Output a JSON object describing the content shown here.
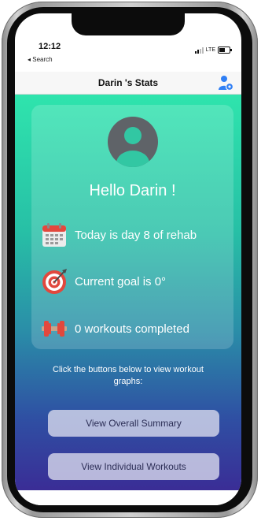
{
  "status_bar": {
    "time": "12:12",
    "back_label": "◂ Search",
    "network": "LTE"
  },
  "nav": {
    "title": "Darin 's Stats"
  },
  "card": {
    "greeting": "Hello Darin !",
    "stats": [
      {
        "icon": "calendar-icon",
        "text": "Today is day 8 of rehab"
      },
      {
        "icon": "target-icon",
        "text": "Current goal is 0°"
      },
      {
        "icon": "dumbbell-icon",
        "text": "0 workouts completed"
      }
    ]
  },
  "hint": "Click the buttons below to view workout graphs:",
  "buttons": {
    "overall": "View Overall Summary",
    "individual": "View Individual Workouts"
  },
  "colors": {
    "accent": "#2f7ff5",
    "gradient_top": "#2fe4ad",
    "gradient_bottom": "#3a2d96",
    "avatar": "#5f6368"
  }
}
